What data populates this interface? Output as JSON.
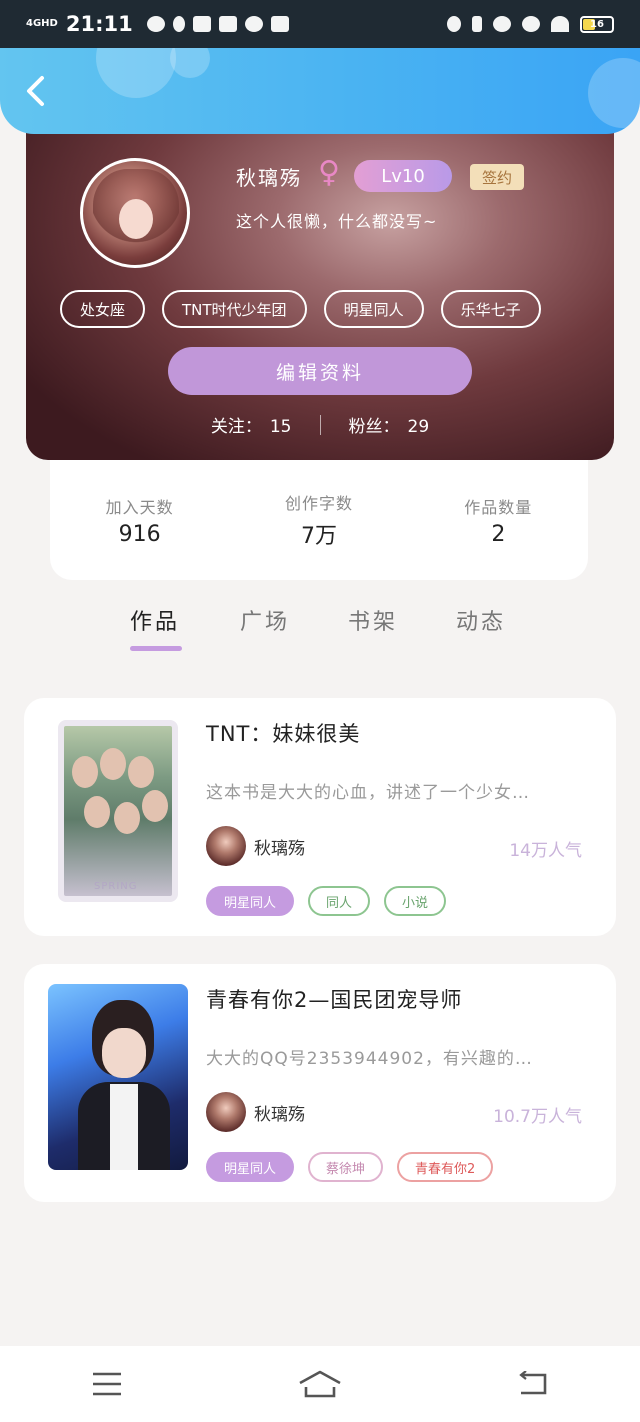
{
  "status_bar": {
    "network": "4GHD",
    "time": "21:11",
    "battery": "16"
  },
  "profile": {
    "name": "秋璃殇",
    "gender_symbol": "♀",
    "level": "Lv10",
    "signed_badge": "签约",
    "bio": "这个人很懒，什么都没写~",
    "tags": [
      "处女座",
      "TNT时代少年团",
      "明星同人",
      "乐华七子"
    ],
    "edit_button": "编辑资料",
    "follow_label": "关注：",
    "follow_count": "15",
    "fans_label": "粉丝：",
    "fans_count": "29"
  },
  "stats": [
    {
      "label": "加入天数",
      "value": "916"
    },
    {
      "label": "创作字数",
      "value": "7万"
    },
    {
      "label": "作品数量",
      "value": "2"
    }
  ],
  "tabs": [
    {
      "label": "作品",
      "active": true
    },
    {
      "label": "广场",
      "active": false
    },
    {
      "label": "书架",
      "active": false
    },
    {
      "label": "动态",
      "active": false
    }
  ],
  "works": [
    {
      "title": "TNT：妹妹很美",
      "description": "这本书是大大的心血，讲述了一个少女…",
      "author": "秋璃殇",
      "popularity": "14万人气",
      "cover_text": "SPRING",
      "tags": [
        "明星同人",
        "同人",
        "小说"
      ]
    },
    {
      "title": "青春有你2—国民团宠导师",
      "description": "大大的QQ号2353944902，有兴趣的…",
      "author": "秋璃殇",
      "popularity": "10.7万人气",
      "tags": [
        "明星同人",
        "蔡徐坤",
        "青春有你2"
      ]
    }
  ],
  "colors": {
    "header": "#4ab3f2",
    "accent_purple": "#c59be0",
    "profile_bg": "#6f3a3e"
  }
}
